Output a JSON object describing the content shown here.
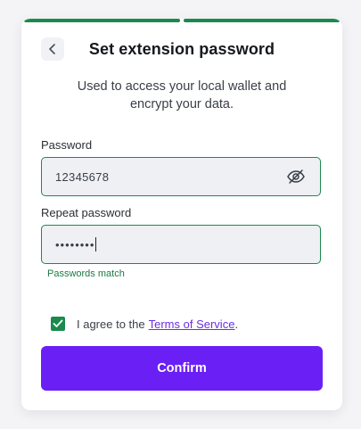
{
  "header": {
    "title": "Set extension password",
    "subtitle": "Used to access your local wallet and encrypt your data.",
    "progress_steps_complete": 2,
    "progress_steps_total": 2
  },
  "form": {
    "password_label": "Password",
    "password_value": "12345678",
    "repeat_label": "Repeat password",
    "repeat_masked": "••••••••",
    "match_hint": "Passwords match"
  },
  "agreement": {
    "checked": true,
    "text": "I agree to the",
    "link_text": "Terms of Service",
    "suffix": "."
  },
  "actions": {
    "confirm_label": "Confirm"
  },
  "colors": {
    "accent_green": "#1b8a4d",
    "primary_purple": "#6a1ff5",
    "link_purple": "#6b2fe0"
  },
  "icons": {
    "back": "chevron-left-icon",
    "visibility": "eye-off-icon",
    "check": "checkmark-icon"
  }
}
